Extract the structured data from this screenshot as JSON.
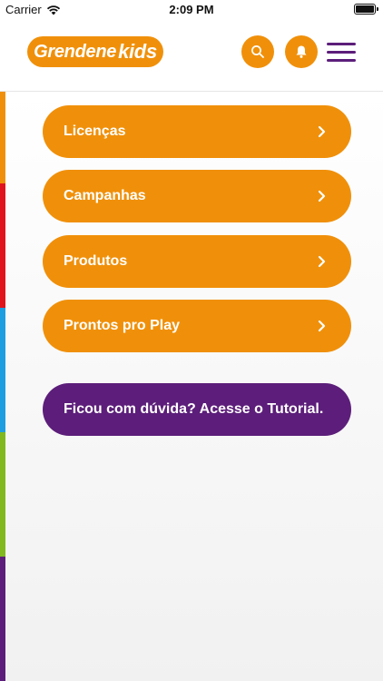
{
  "status_bar": {
    "carrier": "Carrier",
    "time": "2:09 PM"
  },
  "header": {
    "logo_text": "Grendene",
    "logo_suffix": "kids",
    "icons": [
      "search-icon",
      "bell-icon",
      "hamburger-menu-icon"
    ]
  },
  "menu": {
    "items": [
      {
        "label": "Licenças"
      },
      {
        "label": "Campanhas"
      },
      {
        "label": "Produtos"
      },
      {
        "label": "Prontos pro Play"
      }
    ],
    "tutorial_label": "Ficou com dúvida? Acesse o Tutorial."
  },
  "colors": {
    "accent": "#f0900a",
    "purple": "#5c1e7a",
    "stripes": [
      "#f0900a",
      "#e0141c",
      "#1d9ee0",
      "#82b81f",
      "#5c1e7a"
    ]
  }
}
